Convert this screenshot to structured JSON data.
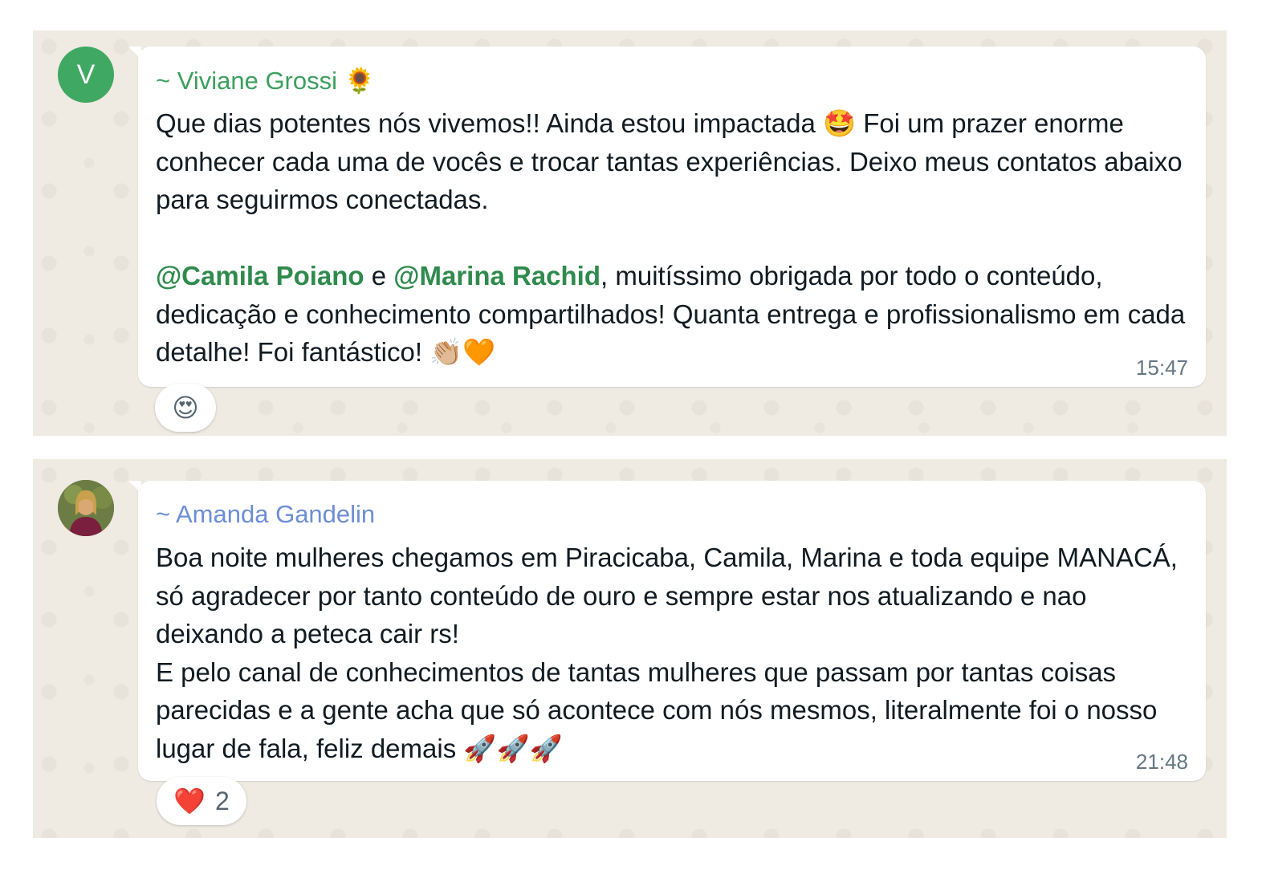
{
  "messages": [
    {
      "avatar_initial": "V",
      "sender": "~ Viviane Grossi",
      "sender_emoji": "🌻",
      "paragraph1_a": "Que dias potentes nós vivemos!! Ainda estou impactada ",
      "paragraph1_emoji": "🤩",
      "paragraph1_b": " Foi um prazer enorme conhecer cada uma de vocês e trocar tantas experiências. Deixo meus contatos abaixo para seguirmos conectadas.",
      "mention1": "@Camila Poiano",
      "connector": " e ",
      "mention2": "@Marina Rachid",
      "paragraph2": ", muitíssimo obrigada por todo o conteúdo, dedicação e conhecimento compartilhados! Quanta entrega e profissionalismo em cada detalhe! Foi fantástico! ",
      "paragraph2_emojis": "👏🏼🧡",
      "time": "15:47",
      "reaction_emoji": "😍"
    },
    {
      "sender": "~ Amanda Gandelin",
      "text_a": "Boa noite mulheres  chegamos em Piracicaba, Camila, Marina e toda equipe MANACÁ, só agradecer por tanto conteúdo de ouro e sempre estar nos atualizando e nao deixando a peteca cair rs!\nE pelo canal de conhecimentos de tantas mulheres que passam por tantas coisas parecidas e a gente acha que só acontece com nós mesmos, literalmente foi o nosso lugar de fala, feliz demais ",
      "text_emojis": "🚀🚀🚀",
      "time": "21:48",
      "reaction_emoji": "❤️",
      "reaction_count": "2"
    }
  ],
  "colors": {
    "chat_background": "#efeae2",
    "sender1": "#3c9f5e",
    "sender2": "#6c8ed8",
    "mention": "#2f8a4d",
    "avatar_v": "#3fa862",
    "timestamp": "#667781"
  },
  "icons": [
    "avatar-v",
    "avatar-photo",
    "sunflower-emoji",
    "star-struck-emoji",
    "clapping-emoji",
    "orange-heart-emoji",
    "rocket-emoji",
    "heart-eyes-emoji",
    "red-heart-emoji"
  ]
}
